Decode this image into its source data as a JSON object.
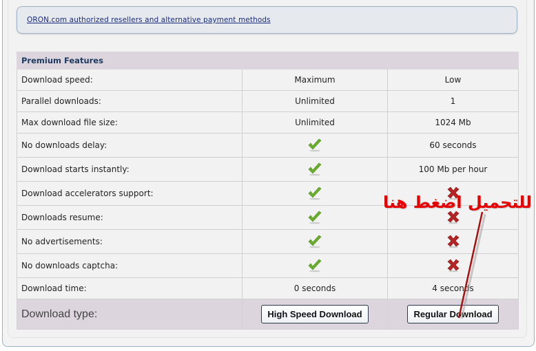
{
  "resellers": {
    "link_text": "ORON.com authorized resellers and alternative payment methods"
  },
  "table": {
    "header": "Premium Features",
    "rows": [
      {
        "label": "Download speed:",
        "premium": "Maximum",
        "free": "Low"
      },
      {
        "label": "Parallel downloads:",
        "premium": "Unlimited",
        "free": "1"
      },
      {
        "label": "Max download file size:",
        "premium": "Unlimited",
        "free": "1024 Mb"
      },
      {
        "label": "No downloads delay:",
        "premium": "check-icon",
        "free": "60 seconds"
      },
      {
        "label": "Download starts instantly:",
        "premium": "check-icon",
        "free": "100 Mb per hour"
      },
      {
        "label": "Download accelerators support:",
        "premium": "check-icon",
        "free": "cross-icon"
      },
      {
        "label": "Downloads resume:",
        "premium": "check-icon",
        "free": "cross-icon"
      },
      {
        "label": "No advertisements:",
        "premium": "check-icon",
        "free": "cross-icon"
      },
      {
        "label": "No downloads captcha:",
        "premium": "check-icon",
        "free": "cross-icon"
      },
      {
        "label": "Download time:",
        "premium": "0 seconds",
        "free": "4 seconds"
      }
    ],
    "footer": {
      "label": "Download type:",
      "premium_button": "High Speed Download",
      "free_button": "Regular Download"
    }
  },
  "annotation": {
    "text": "للتحميل اضغط هنا",
    "color": "#e60000"
  },
  "colors": {
    "check": "#6ab02c",
    "cross": "#b52424",
    "header_bg": "#ddd5dd",
    "header_text": "#1f3a60"
  }
}
